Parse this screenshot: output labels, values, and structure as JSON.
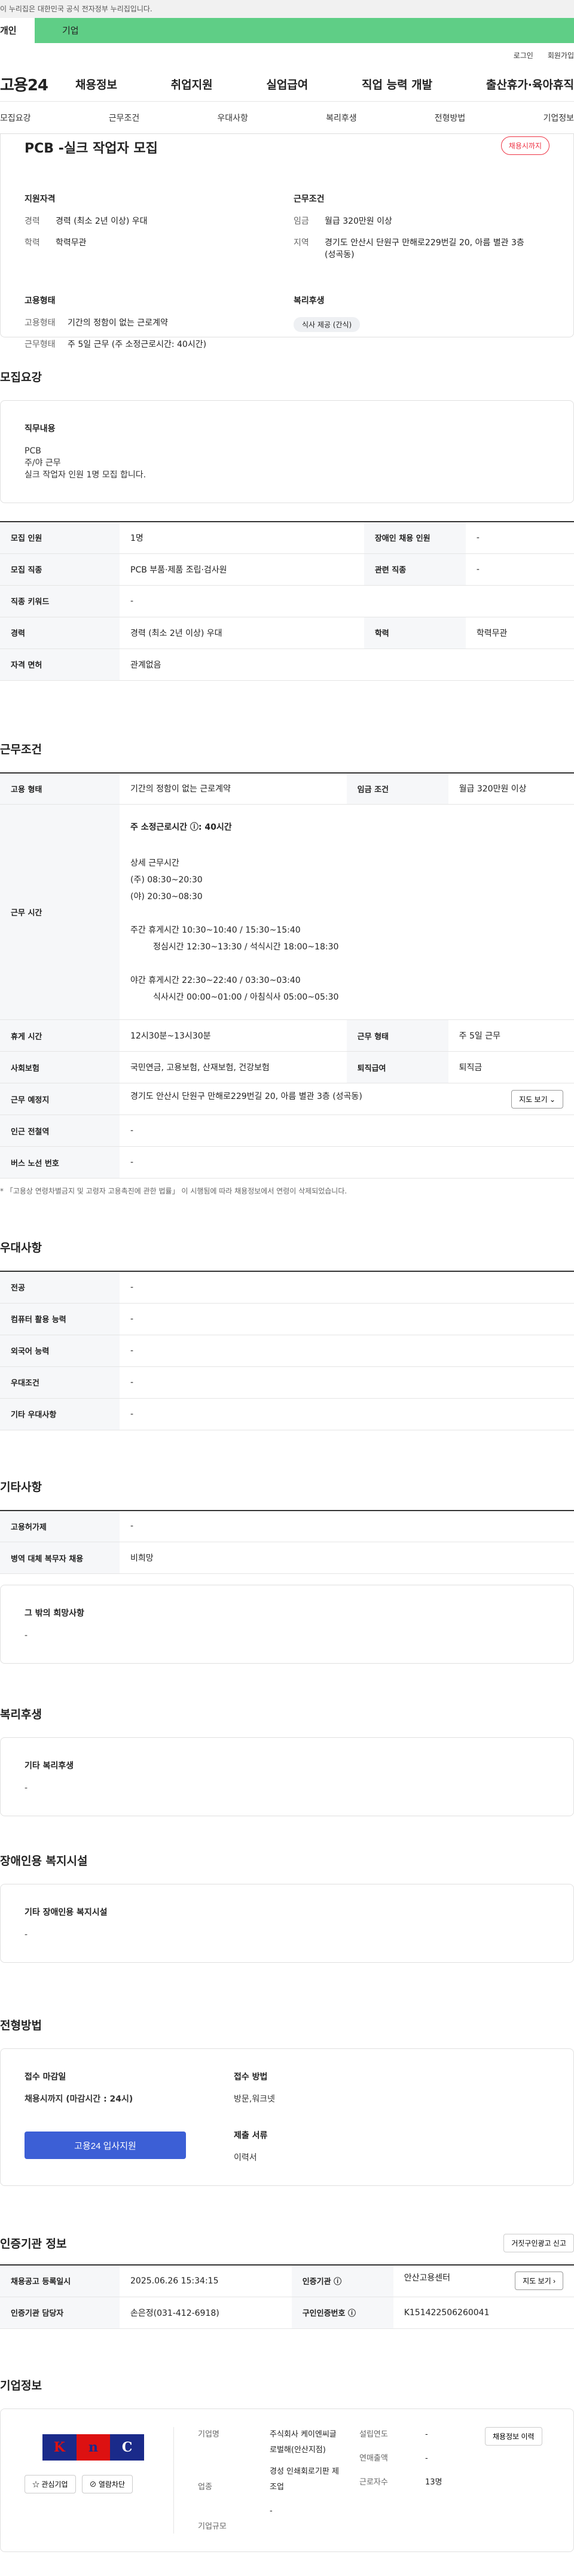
{
  "gov_bar": "이 누리집은 대한민국 공식 전자정부 누리집입니다.",
  "user_types": [
    "개인",
    "기업"
  ],
  "util": [
    "로그인",
    "회원가입"
  ],
  "logo": "고용24",
  "gnb": [
    "채용정보",
    "취업지원",
    "실업급여",
    "직업 능력 개발",
    "출산휴가·육아휴직"
  ],
  "tabs": [
    "모집요강",
    "근무조건",
    "우대사항",
    "복리후생",
    "전형방법",
    "기업정보"
  ],
  "summary": {
    "title": "PCB -실크 작업자 모집",
    "badge": "채용시까지",
    "qual_h": "지원자격",
    "qual": [
      {
        "k": "경력",
        "v": "경력 (최소 2년 이상) 우대"
      },
      {
        "k": "학력",
        "v": "학력무관"
      }
    ],
    "cond_h": "근무조건",
    "cond": [
      {
        "k": "임금",
        "v": "월급 320만원 이상"
      },
      {
        "k": "지역",
        "v": "경기도 안산시 단원구 만해로229번길 20, 아름 별관 3층 (성곡동)"
      }
    ],
    "emp_h": "고용형태",
    "emp": [
      {
        "k": "고용형태",
        "v": "기간의 정함이 없는 근로계약"
      },
      {
        "k": "근무형태",
        "v": "주 5일 근무 (주 소정근로시간: 40시간)"
      }
    ],
    "welfare_h": "복리후생",
    "welfare": "식사 제공 (간식)"
  },
  "recruit": {
    "title": "모집요강",
    "job_h": "직무내용",
    "job_lines": [
      "PCB",
      "주/야 근무",
      "실크 작업자 인원 1명  모집 합니다."
    ],
    "rows": [
      [
        "모집 인원",
        "1명",
        "장애인 채용 인원",
        "-"
      ],
      [
        "모집 직종",
        "PCB 부품·제품 조립·검사원",
        "관련 직종",
        "-"
      ],
      [
        "직종 키워드",
        "-"
      ],
      [
        "경력",
        "경력 (최소 2년 이상) 우대",
        "학력",
        "학력무관"
      ],
      [
        "자격 면허",
        "관계없음"
      ]
    ]
  },
  "work": {
    "title": "근무조건",
    "r1": [
      "고용 형태",
      "기간의 정함이 없는 근로계약",
      "임금 조건",
      "월급 320만원 이상"
    ],
    "time_h": "근무 시간",
    "time_lines": [
      "주 소정근로시간 ⓘ: 40시간",
      "상세 근무시간",
      "(주) 08:30~20:30",
      "(야) 20:30~08:30",
      "주간 휴게시간 10:30~10:40 / 15:30~15:40",
      "정심시간 12:30~13:30 / 석식시간 18:00~18:30",
      "야간 휴게시간 22:30~22:40 / 03:30~03:40",
      "식사시간 00:00~01:00 / 아침식사 05:00~05:30"
    ],
    "r3": [
      "휴게 시간",
      "12시30분~13시30분",
      "근무 형태",
      "주 5일 근무"
    ],
    "r4": [
      "사회보험",
      "국민연금, 고용보험, 산재보험, 건강보험",
      "퇴직급여",
      "퇴직금"
    ],
    "r5": [
      "근무 예정지",
      "경기도 안산시 단원구 만해로229번길 20, 아름 별관 3층 (성곡동)"
    ],
    "map": "지도 보기 ⌄",
    "r6": [
      "인근 전철역",
      "-"
    ],
    "r7": [
      "버스 노선 번호",
      "-"
    ],
    "note": "* 「고용상 연령차별금지 및 고령자 고용촉진에 관한 법률」 이 시행됨에 따라 채용정보에서 연령이 삭제되었습니다."
  },
  "pref": {
    "title": "우대사항",
    "rows": [
      [
        "전공",
        "-"
      ],
      [
        "컴퓨터 활용 능력",
        "-"
      ],
      [
        "외국어 능력",
        "-"
      ],
      [
        "우대조건",
        "-"
      ],
      [
        "기타 우대사항",
        "-"
      ]
    ]
  },
  "etc": {
    "title": "기타사항",
    "rows": [
      [
        "고용허가제",
        "-"
      ],
      [
        "병역 대체 복무자 채용",
        "비희망"
      ]
    ],
    "box_h": "그 밖의 희망사항",
    "box_v": "-"
  },
  "benefit": {
    "title": "복리후생",
    "box_h": "기타 복리후생",
    "box_v": "-"
  },
  "disab": {
    "title": "장애인용 복지시설",
    "box_h": "기타 장애인용 복지시설",
    "box_v": "-"
  },
  "process": {
    "title": "전형방법",
    "deadline_h": "접수 마감일",
    "deadline_v": "채용시까지 (마감시간 : 24시)",
    "method_h": "접수 방법",
    "method_v": "방문,워크넷",
    "docs_h": "제출 서류",
    "docs_v": "이력서",
    "apply": "고용24 입사지원"
  },
  "cert": {
    "title": "인증기관 정보",
    "report": "거짓구인광고 신고",
    "r1": [
      "채용공고 등록일시",
      "2025.06.26 15:34:15",
      "인증기관 ⓘ",
      "안산고용센터"
    ],
    "map": "지도 보기 ›",
    "r2": [
      "인증기관 담당자",
      "손은정(031-412-6918)",
      "구인인증번호 ⓘ",
      "K151422506260041"
    ]
  },
  "company": {
    "title": "기업정보",
    "logo_letters": [
      "K",
      "n",
      "C"
    ],
    "fav": "☆ 관심기업",
    "block": "⊘ 열람차단",
    "name_k": "기업명",
    "name_v": "주식회사 케이엔씨글로벌해(안산지점)",
    "ind_k": "업종",
    "ind_v": "경성 인쇄회로기판 제조업",
    "size_k": "기업규모",
    "size_v": "-",
    "est_k": "설립연도",
    "est_v": "-",
    "sales_k": "연매출액",
    "sales_v": "-",
    "emp_k": "근로자수",
    "emp_v": "13명",
    "history": "채용정보 이력"
  }
}
